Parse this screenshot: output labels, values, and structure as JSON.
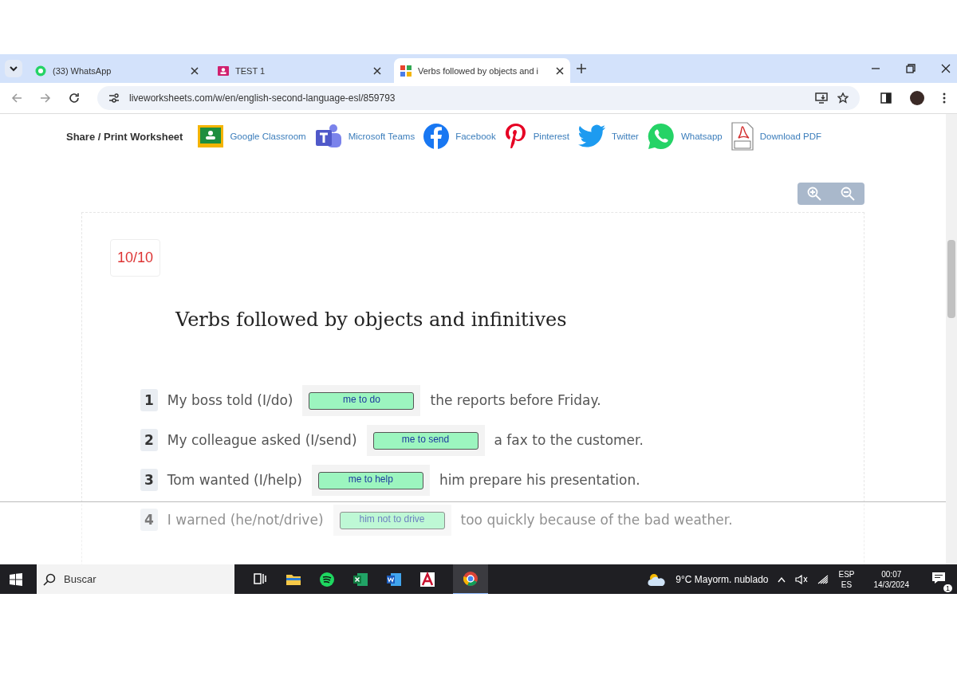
{
  "browser": {
    "tabs": [
      {
        "title": "(33) WhatsApp",
        "kind": "chat",
        "selected": false
      },
      {
        "title": "TEST 1",
        "kind": "form",
        "selected": false
      },
      {
        "title": "Verbs followed by objects and i",
        "kind": "grid",
        "selected": true
      }
    ],
    "url": "liveworksheets.com/w/en/english-second-language-esl/859793"
  },
  "share_bar": {
    "label": "Share / Print Worksheet",
    "links": [
      {
        "label": "Google Classroom",
        "kind": "classroom"
      },
      {
        "label": "Microsoft Teams",
        "kind": "teams"
      },
      {
        "label": "Facebook",
        "kind": "facebook"
      },
      {
        "label": "Pinterest",
        "kind": "pinterest"
      },
      {
        "label": "Twitter",
        "kind": "twitter"
      },
      {
        "label": "Whatsapp",
        "kind": "whatsapp"
      },
      {
        "label": "Download PDF",
        "kind": "pdf"
      }
    ]
  },
  "worksheet": {
    "score": "10/10",
    "title": "Verbs followed by objects and infinitives",
    "items": [
      {
        "number": "1",
        "before": "My boss told (I/do)",
        "answer": "me to do",
        "after": "the reports before Friday.",
        "correct": true
      },
      {
        "number": "2",
        "before": "My colleague asked (I/send)",
        "answer": "me to send",
        "after": "a fax to the customer.",
        "correct": true
      },
      {
        "number": "3",
        "before": "Tom wanted (I/help)",
        "answer": "me to help",
        "after": "him prepare his presentation.",
        "correct": true
      },
      {
        "number": "4",
        "before": "I warned (he/not/drive)",
        "answer": "him not to drive",
        "after": "too quickly because of the bad weather.",
        "correct": true
      }
    ]
  },
  "taskbar": {
    "search_placeholder": "Buscar",
    "weather": "9°C  Mayorm. nublado",
    "language": [
      "ESP",
      "ES"
    ],
    "time": "00:07",
    "date": "14/3/2024",
    "notifications": "1"
  }
}
